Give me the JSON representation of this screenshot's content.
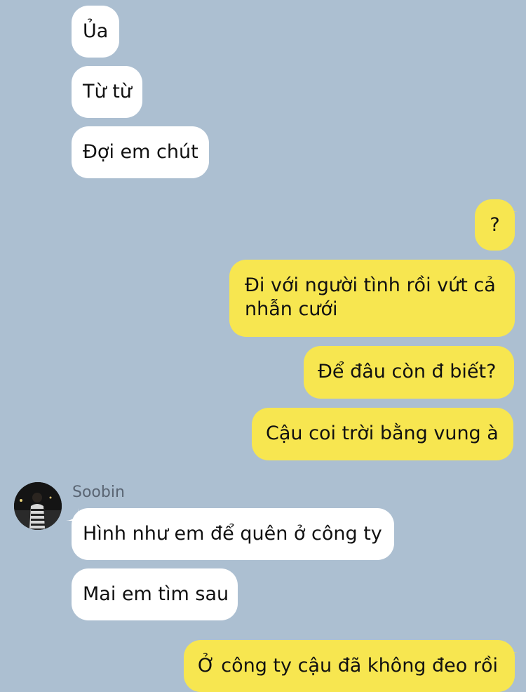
{
  "contact": {
    "name": "Soobin"
  },
  "messages": [
    {
      "id": "m1",
      "direction": "in",
      "text": "Ủa"
    },
    {
      "id": "m2",
      "direction": "in",
      "text": "Từ từ"
    },
    {
      "id": "m3",
      "direction": "in",
      "text": "Đợi em chút"
    },
    {
      "id": "m4",
      "direction": "out",
      "text": "?"
    },
    {
      "id": "m5",
      "direction": "out",
      "text": "Đi với người tình rồi vứt cả nhẫn cưới"
    },
    {
      "id": "m6",
      "direction": "out",
      "text": "Để đâu còn đ biết?"
    },
    {
      "id": "m7",
      "direction": "out",
      "text": "Cậu coi trời bằng vung à"
    },
    {
      "id": "m8",
      "direction": "in",
      "text": "Hình như em để quên ở công ty"
    },
    {
      "id": "m9",
      "direction": "in",
      "text": "Mai em tìm sau"
    },
    {
      "id": "m10",
      "direction": "out",
      "text": "Ở công ty cậu đã không đeo rồi"
    }
  ],
  "colors": {
    "background": "#acbfd1",
    "incoming_bubble": "#ffffff",
    "outgoing_bubble": "#f7e650",
    "sender_name": "#5a6573"
  },
  "icons": {
    "avatar": "profile-photo"
  }
}
